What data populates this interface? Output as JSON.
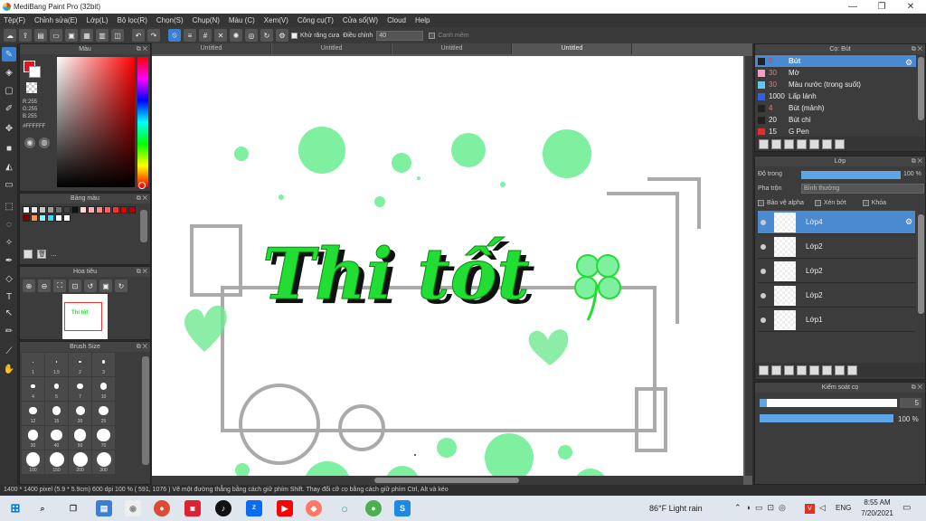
{
  "window": {
    "title": "MediBang Paint Pro (32bit)"
  },
  "menu": [
    "Tệp(F)",
    "Chỉnh sửa(E)",
    "Lớp(L)",
    "Bộ lọc(R)",
    "Chọn(S)",
    "Chụp(N)",
    "Màu (C)",
    "Xem(V)",
    "Công cụ(T)",
    "Cửa sổ(W)",
    "Cloud",
    "Help"
  ],
  "toolbar": {
    "antialias_label": "Khử răng cưa",
    "adjust_label": "Điều chỉnh",
    "adjust_value": "40",
    "smooth_label": "Canh mềm"
  },
  "color_panel": {
    "title": "Màu",
    "r": "R:255",
    "g": "G:255",
    "b": "B:255",
    "hex": "#FFFFFF",
    "fg_color": "#e0161e"
  },
  "palette_panel": {
    "title": "Bảng màu",
    "dots": "...",
    "swatches": [
      "#ffffff",
      "#e8e8e8",
      "#c8c8c8",
      "#a0a0a0",
      "#707070",
      "#404040",
      "#101010",
      "#ffd8d8",
      "#ffb0b0",
      "#ff8a8a",
      "#ff6060",
      "#ff3030",
      "#e00000",
      "#b00000",
      "#800000",
      "#ff9050",
      "#8cf0ff",
      "#40d8f0",
      "#ffffff",
      "#f8f8ff"
    ]
  },
  "navigator_panel": {
    "title": "Hoa tiêu"
  },
  "brushsize_panel": {
    "title": "Brush Size",
    "sizes": [
      "1",
      "1.5",
      "2",
      "3",
      "4",
      "5",
      "7",
      "10",
      "12",
      "15",
      "20",
      "25",
      "30",
      "40",
      "50",
      "70",
      "100",
      "150",
      "200",
      "300"
    ]
  },
  "brush_panel": {
    "title": "Cọ: Bút",
    "items": [
      {
        "size": "5",
        "name": "Bút",
        "color": "#222222"
      },
      {
        "size": "30",
        "name": "Mờ",
        "color": "#f0a0c0"
      },
      {
        "size": "30",
        "name": "Màu nước (trong suốt)",
        "color": "#60c8f0"
      },
      {
        "size": "1000",
        "name": "Lấp lánh",
        "color": "#3060e0"
      },
      {
        "size": "4",
        "name": "Bút (mảnh)",
        "color": "#222222"
      },
      {
        "size": "20",
        "name": "Bút chì",
        "color": "#222222"
      },
      {
        "size": "15",
        "name": "G Pen",
        "color": "#e03030"
      }
    ]
  },
  "layer_panel": {
    "title": "Lớp",
    "opacity_label": "Độ trong",
    "opacity_value": "100 %",
    "blend_label": "Pha trộn",
    "blend_value": "Bình thường",
    "protect_alpha": "Bảo vệ alpha",
    "clipping": "Xén bớt",
    "lock": "Khóa",
    "layers": [
      {
        "name": "Lớp4",
        "selected": true
      },
      {
        "name": "Lớp2",
        "selected": false
      },
      {
        "name": "Lớp2",
        "selected": false
      },
      {
        "name": "Lớp2",
        "selected": false
      },
      {
        "name": "Lớp1",
        "selected": false
      }
    ]
  },
  "brush_control": {
    "title": "Kiểm soát cọ",
    "size_value": "5",
    "opacity_value": "100 %",
    "size_fraction": 0.05,
    "opacity_fraction": 1.0
  },
  "documents": {
    "tabs": [
      "Untitled",
      "Untitled",
      "Untitled",
      "Untitled"
    ]
  },
  "artwork": {
    "text": "Thi tốt",
    "text_color": "#22dd33",
    "shape_color": "#aaaaaa",
    "dot_color": "#7ef0a0"
  },
  "status": {
    "text": "1400 * 1400 pixel   (5.9 * 5.9cm)   600 dpi   100 %   ( 591, 1076 )   Vẽ một đường thẳng bằng cách giữ phím Shift. Thay đổi cỡ cọ bằng cách giữ phím Ctrl, Alt và kéo"
  },
  "taskbar": {
    "weather": "86°F  Light rain",
    "lang": "ENG",
    "time": "8:55 AM",
    "date": "7/20/2021"
  }
}
